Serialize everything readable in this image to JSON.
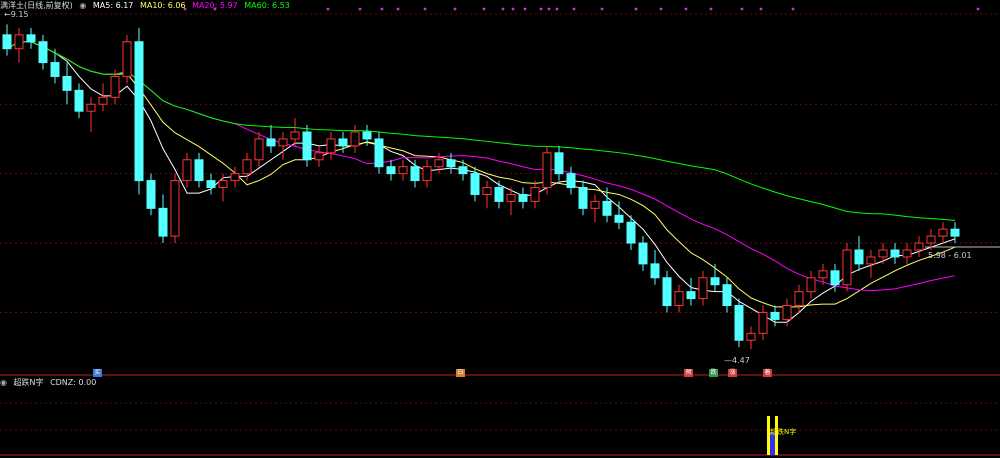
{
  "header": {
    "stock_name": "满洋土(日线,前复权)",
    "ma5_label": "MA5: 6.17",
    "ma10_label": "MA10: 6.06",
    "ma20_label": "MA20: 5.97",
    "ma60_label": "MA60: 6.53"
  },
  "indicator": {
    "name": "超跌N字",
    "value_label": "CDNZ: 0.00",
    "bar_text": "超跌N字"
  },
  "markers": [
    {
      "label": "买",
      "color": "#3a7bd5"
    },
    {
      "label": "日",
      "color": "#d08030"
    },
    {
      "label": "预",
      "color": "#d04040"
    },
    {
      "label": "跌",
      "color": "#30a050"
    },
    {
      "label": "涨",
      "color": "#d04040"
    },
    {
      "label": "着",
      "color": "#d04040"
    }
  ],
  "annotations": {
    "high": "9.15",
    "low": "4.47",
    "range": "5.98 - 6.01"
  },
  "colors": {
    "up": "#ff3333",
    "down": "#54ffff",
    "ma5": "#ffffff",
    "ma10": "#ffff66",
    "ma20": "#ff00ff",
    "ma60": "#00ff00",
    "grid": "#7a1010",
    "indicator_bar": "#ffff00"
  },
  "chart_data": {
    "type": "candlestick",
    "title": "满洋土(日线,前复权)",
    "ylim": [
      4.2,
      9.3
    ],
    "ohlc": [
      [
        9.0,
        9.15,
        8.7,
        8.8
      ],
      [
        8.8,
        9.1,
        8.6,
        9.0
      ],
      [
        9.0,
        9.1,
        8.8,
        8.9
      ],
      [
        8.9,
        9.0,
        8.5,
        8.6
      ],
      [
        8.6,
        8.8,
        8.3,
        8.4
      ],
      [
        8.4,
        8.6,
        8.0,
        8.2
      ],
      [
        8.2,
        8.3,
        7.8,
        7.9
      ],
      [
        7.9,
        8.1,
        7.6,
        8.0
      ],
      [
        8.0,
        8.3,
        7.9,
        8.1
      ],
      [
        8.1,
        8.5,
        8.0,
        8.4
      ],
      [
        8.4,
        9.0,
        8.3,
        8.9
      ],
      [
        8.9,
        9.1,
        6.7,
        6.9
      ],
      [
        6.9,
        7.0,
        6.4,
        6.5
      ],
      [
        6.5,
        6.7,
        6.0,
        6.1
      ],
      [
        6.1,
        7.0,
        6.0,
        6.9
      ],
      [
        6.9,
        7.3,
        6.8,
        7.2
      ],
      [
        7.2,
        7.3,
        6.8,
        6.9
      ],
      [
        6.9,
        7.0,
        6.7,
        6.8
      ],
      [
        6.8,
        7.0,
        6.6,
        6.9
      ],
      [
        6.9,
        7.1,
        6.8,
        7.0
      ],
      [
        7.0,
        7.3,
        6.9,
        7.2
      ],
      [
        7.2,
        7.6,
        7.1,
        7.5
      ],
      [
        7.5,
        7.7,
        7.3,
        7.4
      ],
      [
        7.4,
        7.6,
        7.2,
        7.5
      ],
      [
        7.5,
        7.8,
        7.4,
        7.6
      ],
      [
        7.6,
        7.7,
        7.1,
        7.2
      ],
      [
        7.2,
        7.4,
        7.1,
        7.3
      ],
      [
        7.3,
        7.6,
        7.2,
        7.5
      ],
      [
        7.5,
        7.6,
        7.3,
        7.4
      ],
      [
        7.4,
        7.7,
        7.3,
        7.6
      ],
      [
        7.6,
        7.7,
        7.4,
        7.5
      ],
      [
        7.5,
        7.6,
        7.0,
        7.1
      ],
      [
        7.1,
        7.2,
        6.9,
        7.0
      ],
      [
        7.0,
        7.2,
        6.9,
        7.1
      ],
      [
        7.1,
        7.2,
        6.8,
        6.9
      ],
      [
        6.9,
        7.2,
        6.8,
        7.1
      ],
      [
        7.1,
        7.3,
        7.0,
        7.2
      ],
      [
        7.2,
        7.3,
        7.0,
        7.1
      ],
      [
        7.1,
        7.2,
        6.9,
        7.0
      ],
      [
        7.0,
        7.1,
        6.6,
        6.7
      ],
      [
        6.7,
        6.9,
        6.5,
        6.8
      ],
      [
        6.8,
        6.9,
        6.5,
        6.6
      ],
      [
        6.6,
        6.8,
        6.4,
        6.7
      ],
      [
        6.7,
        6.8,
        6.5,
        6.6
      ],
      [
        6.6,
        6.9,
        6.5,
        6.8
      ],
      [
        6.8,
        7.4,
        6.7,
        7.3
      ],
      [
        7.3,
        7.4,
        6.9,
        7.0
      ],
      [
        7.0,
        7.1,
        6.7,
        6.8
      ],
      [
        6.8,
        6.9,
        6.4,
        6.5
      ],
      [
        6.5,
        6.7,
        6.3,
        6.6
      ],
      [
        6.6,
        6.8,
        6.3,
        6.4
      ],
      [
        6.4,
        6.6,
        6.2,
        6.3
      ],
      [
        6.3,
        6.4,
        5.9,
        6.0
      ],
      [
        6.0,
        6.1,
        5.6,
        5.7
      ],
      [
        5.7,
        5.9,
        5.4,
        5.5
      ],
      [
        5.5,
        5.6,
        5.0,
        5.1
      ],
      [
        5.1,
        5.4,
        5.0,
        5.3
      ],
      [
        5.3,
        5.5,
        5.1,
        5.2
      ],
      [
        5.2,
        5.6,
        5.1,
        5.5
      ],
      [
        5.5,
        5.7,
        5.3,
        5.4
      ],
      [
        5.4,
        5.5,
        5.0,
        5.1
      ],
      [
        5.1,
        5.2,
        4.5,
        4.6
      ],
      [
        4.6,
        4.8,
        4.47,
        4.7
      ],
      [
        4.7,
        5.1,
        4.6,
        5.0
      ],
      [
        5.0,
        5.1,
        4.8,
        4.9
      ],
      [
        4.9,
        5.2,
        4.8,
        5.1
      ],
      [
        5.1,
        5.4,
        5.0,
        5.3
      ],
      [
        5.3,
        5.6,
        5.2,
        5.5
      ],
      [
        5.5,
        5.7,
        5.4,
        5.6
      ],
      [
        5.6,
        5.7,
        5.3,
        5.4
      ],
      [
        5.4,
        6.0,
        5.3,
        5.9
      ],
      [
        5.9,
        6.1,
        5.6,
        5.7
      ],
      [
        5.7,
        5.9,
        5.5,
        5.8
      ],
      [
        5.8,
        6.0,
        5.7,
        5.9
      ],
      [
        5.9,
        6.0,
        5.7,
        5.8
      ],
      [
        5.8,
        6.0,
        5.7,
        5.9
      ],
      [
        5.9,
        6.1,
        5.8,
        6.0
      ],
      [
        6.0,
        6.2,
        5.9,
        6.1
      ],
      [
        6.1,
        6.3,
        6.0,
        6.2
      ],
      [
        6.2,
        6.3,
        6.0,
        6.1
      ]
    ]
  }
}
